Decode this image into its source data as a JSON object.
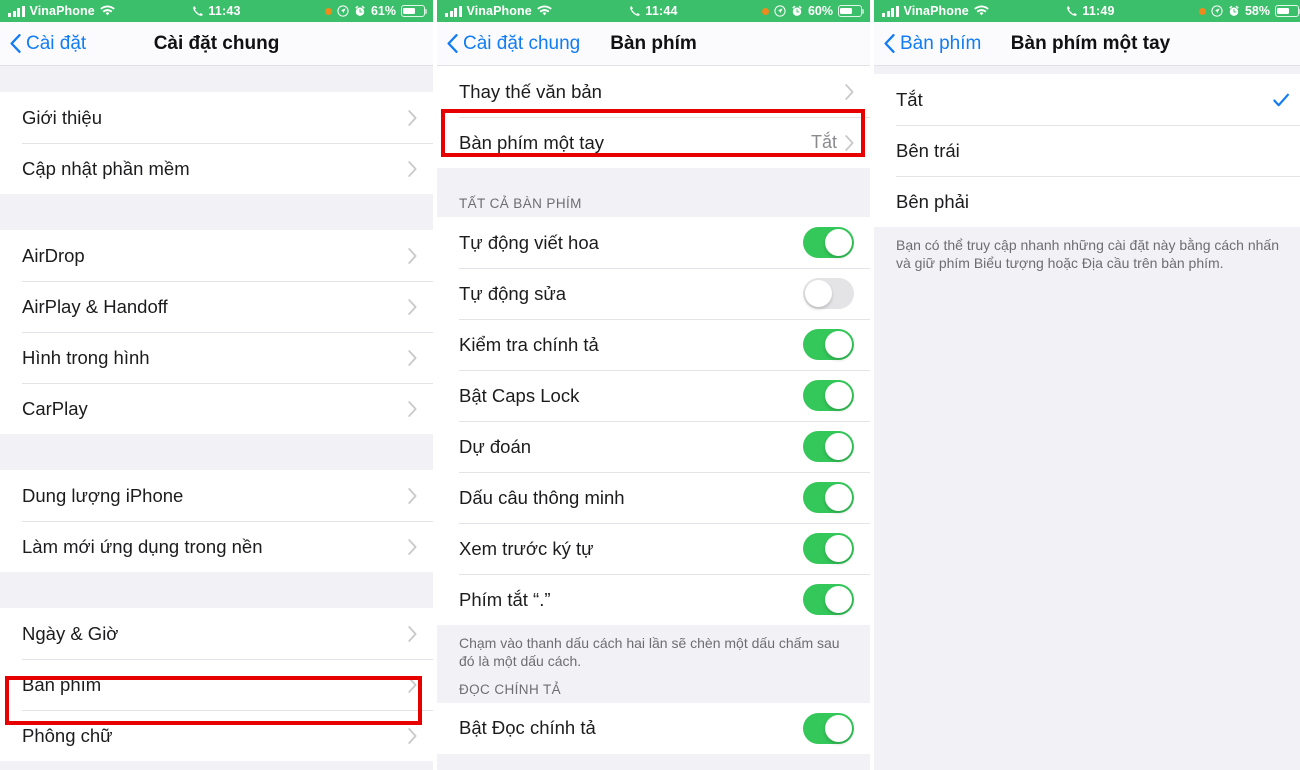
{
  "theme": {
    "status_bar_green": "#3cbf6a",
    "accent_blue": "#127cf4",
    "switch_on_green": "#34c759",
    "highlight_red": "#e60000",
    "group_bg": "#f1f1f6"
  },
  "screens": [
    {
      "id": "general-settings",
      "status": {
        "carrier": "VinaPhone",
        "time": "11:43",
        "battery_percent": "61%",
        "icons": [
          "signal-bars-icon",
          "wifi-icon",
          "phone-call-icon",
          "orange-dot-icon",
          "location-arrow-icon",
          "alarm-clock-icon",
          "battery-icon"
        ]
      },
      "nav": {
        "back_label": "Cài đặt",
        "title": "Cài đặt chung"
      },
      "sections": [
        {
          "top_spacer": 26,
          "rows": [
            {
              "label": "Giới thiệu",
              "accessory": "chevron"
            },
            {
              "label": "Cập nhật phần mềm",
              "accessory": "chevron"
            }
          ]
        },
        {
          "top_spacer": 36,
          "rows": [
            {
              "label": "AirDrop",
              "accessory": "chevron"
            },
            {
              "label": "AirPlay & Handoff",
              "accessory": "chevron"
            },
            {
              "label": "Hình trong hình",
              "accessory": "chevron"
            },
            {
              "label": "CarPlay",
              "accessory": "chevron"
            }
          ]
        },
        {
          "top_spacer": 36,
          "rows": [
            {
              "label": "Dung lượng iPhone",
              "accessory": "chevron"
            },
            {
              "label": "Làm mới ứng dụng trong nền",
              "accessory": "chevron"
            }
          ]
        },
        {
          "top_spacer": 36,
          "rows": [
            {
              "label": "Ngày & Giờ",
              "accessory": "chevron"
            },
            {
              "label": "Bàn phím",
              "accessory": "chevron",
              "highlighted": true
            },
            {
              "label": "Phông chữ",
              "accessory": "chevron"
            }
          ]
        }
      ]
    },
    {
      "id": "keyboard-settings",
      "status": {
        "carrier": "VinaPhone",
        "time": "11:44",
        "battery_percent": "60%",
        "icons": [
          "signal-bars-icon",
          "wifi-icon",
          "phone-call-icon",
          "orange-dot-icon",
          "location-arrow-icon",
          "alarm-clock-icon",
          "battery-icon"
        ]
      },
      "nav": {
        "back_label": "Cài đặt chung",
        "title": "Bàn phím"
      },
      "rows_top": [
        {
          "label": "Thay thế văn bản",
          "accessory": "chevron"
        },
        {
          "label": "Bàn phím một tay",
          "value": "Tắt",
          "accessory": "chevron",
          "highlighted": true
        }
      ],
      "section_header": "TẤT CẢ BÀN PHÍM",
      "toggles": [
        {
          "label": "Tự động viết hoa",
          "on": true
        },
        {
          "label": "Tự động sửa",
          "on": false
        },
        {
          "label": "Kiểm tra chính tả",
          "on": true
        },
        {
          "label": "Bật Caps Lock",
          "on": true
        },
        {
          "label": "Dự đoán",
          "on": true
        },
        {
          "label": "Dấu câu thông minh",
          "on": true
        },
        {
          "label": "Xem trước ký tự",
          "on": true
        },
        {
          "label": "Phím tắt “.”",
          "on": true
        }
      ],
      "footer_note": "Chạm vào thanh dấu cách hai lần sẽ chèn một dấu chấm sau đó là một dấu cách.",
      "section_header_2": "ĐỌC CHÍNH TẢ",
      "toggles_2": [
        {
          "label": "Bật Đọc chính tả",
          "on": true
        }
      ]
    },
    {
      "id": "one-handed-keyboard",
      "status": {
        "carrier": "VinaPhone",
        "time": "11:49",
        "battery_percent": "58%",
        "icons": [
          "signal-bars-icon",
          "wifi-icon",
          "phone-call-icon",
          "orange-dot-icon",
          "location-arrow-icon",
          "alarm-clock-icon",
          "battery-icon"
        ]
      },
      "nav": {
        "back_label": "Bàn phím",
        "title": "Bàn phím một tay"
      },
      "options": [
        {
          "label": "Tắt",
          "selected": true
        },
        {
          "label": "Bên trái",
          "selected": false
        },
        {
          "label": "Bên phải",
          "selected": false
        }
      ],
      "footer_note": "Bạn có thể truy cập nhanh những cài đặt này bằng cách nhấn và giữ phím Biểu tượng hoặc Địa cầu trên bàn phím."
    }
  ]
}
